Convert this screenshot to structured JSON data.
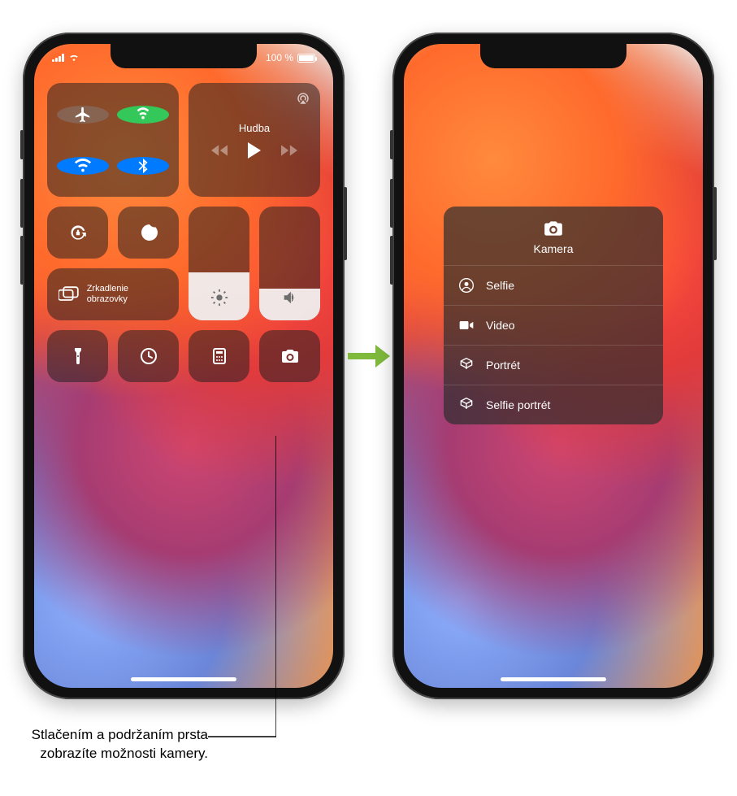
{
  "status": {
    "battery_pct": "100 %"
  },
  "media": {
    "title": "Hudba"
  },
  "mirror": {
    "label": "Zrkadlenie obrazovky"
  },
  "camera_menu": {
    "title": "Kamera",
    "items": [
      "Selfie",
      "Video",
      "Portrét",
      "Selfie portrét"
    ]
  },
  "callout": {
    "text": "Stlačením a podržaním prsta zobrazíte možnosti kamery."
  }
}
